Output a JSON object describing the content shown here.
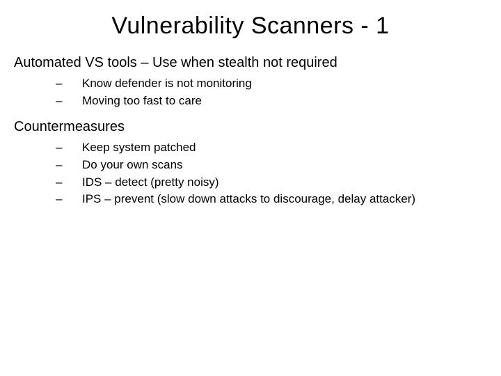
{
  "title": "Vulnerability Scanners - 1",
  "sections": [
    {
      "heading": "Automated VS tools – Use when stealth not required",
      "items": [
        "Know defender is not monitoring",
        "Moving too fast to care"
      ]
    },
    {
      "heading": "Countermeasures",
      "items": [
        "Keep system patched",
        "Do your own scans",
        "IDS – detect (pretty noisy)",
        "IPS – prevent (slow down attacks to discourage, delay attacker)"
      ]
    }
  ]
}
